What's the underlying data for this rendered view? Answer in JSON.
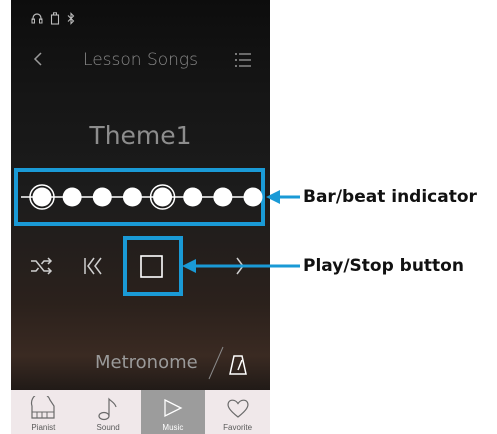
{
  "header": {
    "title": "Lesson Songs"
  },
  "song": {
    "name": "Theme1"
  },
  "metronome": {
    "label": "Metronome"
  },
  "beat_indicator": {
    "total_dots": 8,
    "accent_dots": [
      1,
      5
    ]
  },
  "tabs": [
    {
      "label": "Pianist",
      "icon": "piano-icon",
      "active": false
    },
    {
      "label": "Sound",
      "icon": "note-icon",
      "active": false
    },
    {
      "label": "Music",
      "icon": "play-icon",
      "active": true
    },
    {
      "label": "Favorite",
      "icon": "heart-icon",
      "active": false
    }
  ],
  "annotations": {
    "beat": "Bar/beat indicator",
    "play_stop": "Play/Stop button"
  },
  "colors": {
    "highlight": "#1a9ad6",
    "active_tab": "#9c9c9c",
    "tab_bg": "#f0e8ea"
  }
}
